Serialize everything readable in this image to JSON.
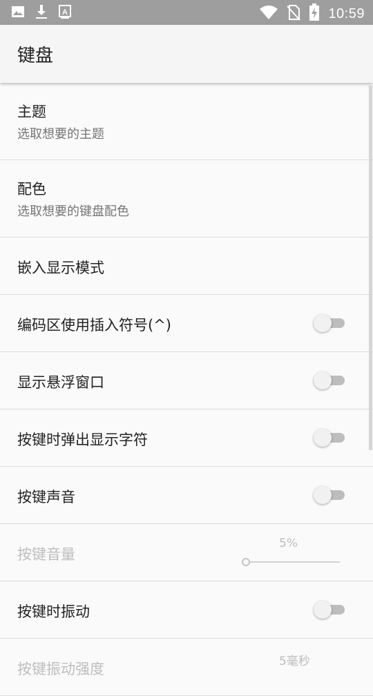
{
  "status_bar": {
    "time": "10:59",
    "icons_left": [
      "image-icon",
      "download-icon",
      "text-a-icon"
    ],
    "icons_right": [
      "wifi-icon",
      "no-sim-icon",
      "battery-charging-icon"
    ]
  },
  "app_bar": {
    "title": "键盘"
  },
  "settings": [
    {
      "title": "主题",
      "summary": "选取想要的主题"
    },
    {
      "title": "配色",
      "summary": "选取想要的键盘配色"
    },
    {
      "title": "嵌入显示模式"
    },
    {
      "title": "编码区使用插入符号(^)",
      "toggle": false
    },
    {
      "title": "显示悬浮窗口",
      "toggle": false
    },
    {
      "title": "按键时弹出显示字符",
      "toggle": false
    },
    {
      "title": "按键声音",
      "toggle": false
    },
    {
      "title": "按键音量",
      "slider_value": "5%",
      "slider_fraction": 0.05,
      "enabled": false
    },
    {
      "title": "按键时振动",
      "toggle": false
    },
    {
      "title": "按键振动强度",
      "slider_value": "5毫秒",
      "enabled": false
    }
  ],
  "colors": {
    "status_bar": "#9e9e9e",
    "app_bar": "#f5f5f5",
    "background": "#fafafa",
    "switch_off_track": "#bdbdbd",
    "disabled_text": "#bdbdbd"
  }
}
